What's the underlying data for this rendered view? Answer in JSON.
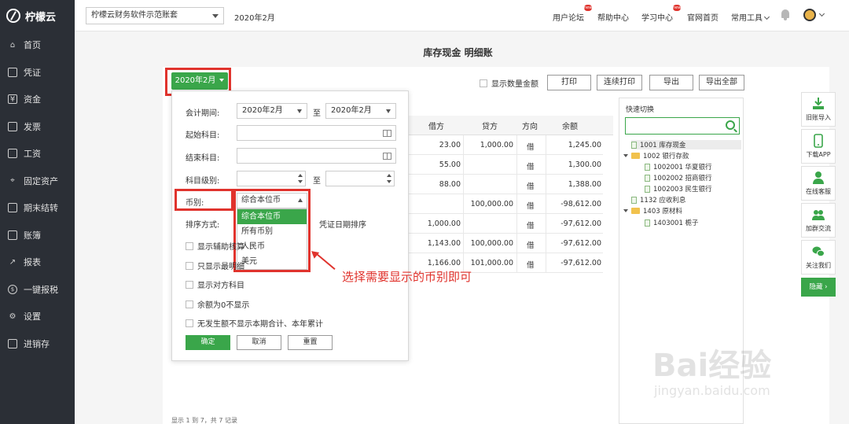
{
  "app": {
    "name": "柠檬云"
  },
  "sidebar": {
    "items": [
      {
        "label": "首页",
        "icon": "home-icon"
      },
      {
        "label": "凭证",
        "icon": "voucher-icon"
      },
      {
        "label": "资金",
        "icon": "yuan-icon"
      },
      {
        "label": "发票",
        "icon": "invoice-icon"
      },
      {
        "label": "工资",
        "icon": "salary-icon"
      },
      {
        "label": "固定资产",
        "icon": "asset-icon"
      },
      {
        "label": "期末结转",
        "icon": "calendar-icon"
      },
      {
        "label": "账簿",
        "icon": "book-icon"
      },
      {
        "label": "报表",
        "icon": "chart-icon"
      },
      {
        "label": "一键报税",
        "icon": "tax-icon"
      },
      {
        "label": "设置",
        "icon": "gear-icon"
      },
      {
        "label": "进销存",
        "icon": "inventory-icon"
      }
    ]
  },
  "topbar": {
    "account": "柠檬云财务软件示范账套",
    "period": "2020年2月",
    "links": [
      "用户论坛",
      "帮助中心",
      "学习中心",
      "官网首页"
    ],
    "tools": "常用工具"
  },
  "page": {
    "title": "库存现金 明细账"
  },
  "toolbar": {
    "period_button": "2020年2月",
    "show_qty": "显示数量金额",
    "print": "打印",
    "batch_print": "连续打印",
    "export": "导出",
    "export_all": "导出全部"
  },
  "table": {
    "headers": [
      "借方",
      "贷方",
      "方向",
      "余额"
    ],
    "rows": [
      {
        "debit": "23.00",
        "credit": "1,000.00",
        "dir": "借",
        "balance": "1,245.00"
      },
      {
        "debit": "55.00",
        "credit": "",
        "dir": "借",
        "balance": "1,300.00"
      },
      {
        "debit": "88.00",
        "credit": "",
        "dir": "借",
        "balance": "1,388.00"
      },
      {
        "debit": "",
        "credit": "100,000.00",
        "dir": "借",
        "balance": "-98,612.00"
      },
      {
        "debit": "1,000.00",
        "credit": "",
        "dir": "借",
        "balance": "-97,612.00"
      },
      {
        "debit": "1,143.00",
        "credit": "100,000.00",
        "dir": "借",
        "balance": "-97,612.00"
      },
      {
        "debit": "1,166.00",
        "credit": "101,000.00",
        "dir": "借",
        "balance": "-97,612.00"
      }
    ]
  },
  "quick": {
    "title": "快速切换",
    "tree": [
      {
        "label": "1001 库存现金",
        "type": "file"
      },
      {
        "label": "1002 银行存款",
        "type": "folder"
      },
      {
        "label": "1002001 华夏银行",
        "type": "file"
      },
      {
        "label": "1002002 招商银行",
        "type": "file"
      },
      {
        "label": "1002003 民生银行",
        "type": "file"
      },
      {
        "label": "1132 应收利息",
        "type": "file"
      },
      {
        "label": "1403 原材料",
        "type": "folder"
      },
      {
        "label": "1403001 栀子",
        "type": "file"
      }
    ]
  },
  "side_tools": {
    "items": [
      "旧账导入",
      "下载APP",
      "在线客服",
      "加群交流",
      "关注我们"
    ],
    "hide": "隐藏 ›"
  },
  "filter": {
    "period_label": "会计期间:",
    "period_from": "2020年2月",
    "to": "至",
    "period_to": "2020年2月",
    "start_subject": "起始科目:",
    "end_subject": "结束科目:",
    "level": "科目级别:",
    "currency_label": "币别:",
    "currency_value": "综合本位币",
    "currency_options": [
      "综合本位币",
      "所有币别",
      "人民币",
      "美元"
    ],
    "sort_label": "排序方式:",
    "sort_extra": "凭证日期排序",
    "checks": [
      "显示辅助核算",
      "只显示最明细",
      "显示对方科目",
      "余额为0不显示",
      "无发生额不显示本期合计、本年累计"
    ],
    "confirm": "确定",
    "cancel": "取消",
    "reset": "重置"
  },
  "annotation": {
    "text": "选择需要显示的币别即可"
  },
  "pager": {
    "text": "显示 1 到 7，共 7 记录"
  },
  "watermark": {
    "text": "Bai经验",
    "sub": "jingyan.baidu.com"
  },
  "colors": {
    "accent": "#3aa64a",
    "highlight": "#e0332d",
    "sidebar": "#2b2f36"
  }
}
